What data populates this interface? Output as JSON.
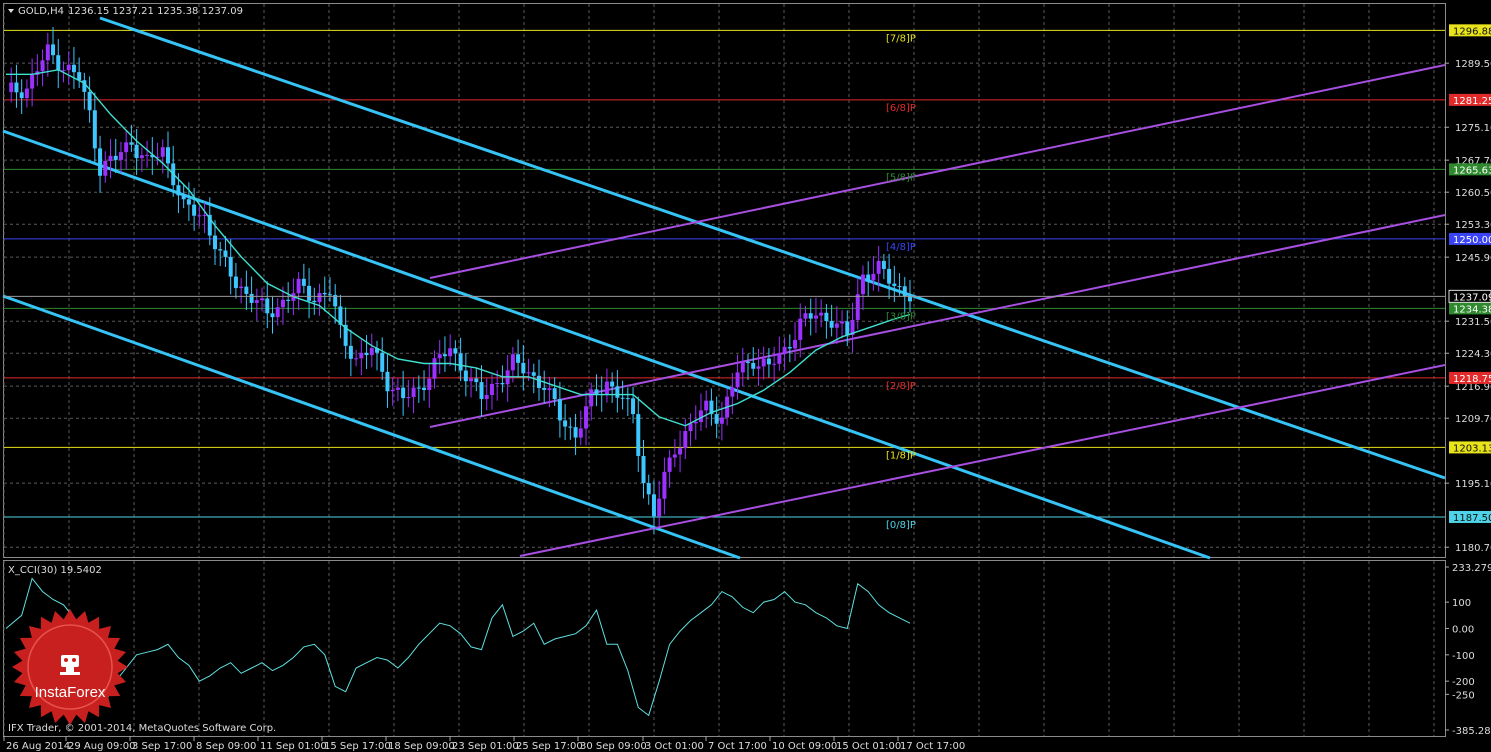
{
  "header": {
    "symbol": "GOLD,H4",
    "ohlc": "1236.15 1237.21 1235.38 1237.09"
  },
  "footer": {
    "copyright": "IFX Trader, © 2001-2014, MetaQuotes Software Corp."
  },
  "logo": {
    "text": "InstaForex",
    "color": "#c8201e"
  },
  "colors": {
    "bull": "#9b30ff",
    "bear": "#3ec6ff",
    "channel": "#36c3f5",
    "fan": "#a64fe0",
    "ma": "#3fe0d0",
    "grid": "#5a5a5a"
  },
  "chart_data": [
    {
      "type": "candlestick",
      "name": "GOLD,H4",
      "ylim": [
        1178.5,
        1302.8
      ],
      "y_ticks": [
        "1289.50",
        "1275.10",
        "1267.70",
        "1260.50",
        "1253.30",
        "1245.90",
        "1231.50",
        "1224.30",
        "1216.90",
        "1209.70",
        "1195.10",
        "1180.70"
      ],
      "x_ticks": [
        "26 Aug 2014",
        "29 Aug 09:00",
        "3 Sep 17:00",
        "8 Sep 09:00",
        "11 Sep 01:00",
        "15 Sep 17:00",
        "18 Sep 09:00",
        "23 Sep 01:00",
        "25 Sep 17:00",
        "30 Sep 09:00",
        "3 Oct 01:00",
        "7 Oct 17:00",
        "10 Oct 09:00",
        "15 Oct 01:00",
        "17 Oct 17:00"
      ],
      "close_path": [
        [
          0,
          1283
        ],
        [
          4,
          1284
        ],
        [
          8,
          1292
        ],
        [
          11,
          1289
        ],
        [
          14,
          1286
        ],
        [
          16,
          1278
        ],
        [
          18,
          1266
        ],
        [
          21,
          1268
        ],
        [
          24,
          1272
        ],
        [
          27,
          1267
        ],
        [
          30,
          1270
        ],
        [
          32,
          1264
        ],
        [
          34,
          1257
        ],
        [
          38,
          1255
        ],
        [
          41,
          1246
        ],
        [
          44,
          1240
        ],
        [
          47,
          1237
        ],
        [
          50,
          1233
        ],
        [
          53,
          1236
        ],
        [
          56,
          1239
        ],
        [
          59,
          1237
        ],
        [
          62,
          1238
        ],
        [
          64,
          1229
        ],
        [
          67,
          1223
        ],
        [
          70,
          1225
        ],
        [
          73,
          1218
        ],
        [
          76,
          1214
        ],
        [
          79,
          1216
        ],
        [
          82,
          1222
        ],
        [
          85,
          1225
        ],
        [
          88,
          1220
        ],
        [
          91,
          1214
        ],
        [
          94,
          1218
        ],
        [
          97,
          1222
        ],
        [
          100,
          1220
        ],
        [
          103,
          1217
        ],
        [
          106,
          1210
        ],
        [
          109,
          1206
        ],
        [
          112,
          1214
        ],
        [
          115,
          1218
        ],
        [
          118,
          1214
        ],
        [
          120,
          1210
        ],
        [
          122,
          1196
        ],
        [
          124,
          1188
        ],
        [
          126,
          1196
        ],
        [
          128,
          1203
        ],
        [
          131,
          1208
        ],
        [
          134,
          1212
        ],
        [
          137,
          1210
        ],
        [
          140,
          1220
        ],
        [
          143,
          1223
        ],
        [
          146,
          1221
        ],
        [
          149,
          1225
        ],
        [
          152,
          1231
        ],
        [
          155,
          1233
        ],
        [
          158,
          1232
        ],
        [
          161,
          1228
        ],
        [
          164,
          1242
        ],
        [
          167,
          1243
        ],
        [
          170,
          1240
        ],
        [
          173,
          1237
        ]
      ],
      "moving_average": [
        [
          0,
          1287
        ],
        [
          5,
          1287
        ],
        [
          10,
          1288
        ],
        [
          15,
          1285
        ],
        [
          20,
          1278
        ],
        [
          25,
          1272
        ],
        [
          30,
          1267
        ],
        [
          35,
          1261
        ],
        [
          40,
          1253
        ],
        [
          45,
          1246
        ],
        [
          50,
          1240
        ],
        [
          55,
          1237
        ],
        [
          60,
          1235
        ],
        [
          65,
          1230
        ],
        [
          70,
          1226
        ],
        [
          75,
          1223
        ],
        [
          80,
          1222
        ],
        [
          85,
          1222
        ],
        [
          90,
          1221
        ],
        [
          95,
          1219
        ],
        [
          100,
          1219
        ],
        [
          105,
          1217
        ],
        [
          110,
          1215
        ],
        [
          115,
          1215
        ],
        [
          120,
          1215
        ],
        [
          125,
          1210
        ],
        [
          130,
          1208
        ],
        [
          135,
          1211
        ],
        [
          140,
          1213
        ],
        [
          145,
          1216
        ],
        [
          150,
          1220
        ],
        [
          155,
          1225
        ],
        [
          160,
          1228
        ],
        [
          165,
          1230
        ],
        [
          170,
          1232
        ],
        [
          173,
          1233
        ]
      ],
      "murrey_levels": [
        {
          "label": "[7/8]P",
          "price": "1296.88",
          "value": 1296.88,
          "color": "#e8e31a",
          "text": "#111111"
        },
        {
          "label": "[6/8]P",
          "price": "1281.25",
          "value": 1281.25,
          "color": "#e22a2a",
          "text": "#ffffff"
        },
        {
          "label": "[5/8]P",
          "price": "1265.63",
          "value": 1265.63,
          "color": "#2f8a2f",
          "text": "#ffffff"
        },
        {
          "label": "[4/8]P",
          "price": "1250.00",
          "value": 1250.0,
          "color": "#3a44f5",
          "text": "#ffffff"
        },
        {
          "label": "[3/8]P",
          "price": "1234.38",
          "value": 1234.38,
          "color": "#2f8a2f",
          "text": "#ffffff"
        },
        {
          "label": "[2/8]P",
          "price": "1218.75",
          "value": 1218.75,
          "color": "#e22a2a",
          "text": "#ffffff"
        },
        {
          "label": "[1/8]P",
          "price": "1203.13",
          "value": 1203.13,
          "color": "#e8e31a",
          "text": "#111111"
        },
        {
          "label": "[0/8]P",
          "price": "1187.50",
          "value": 1187.5,
          "color": "#4fd3e8",
          "text": "#111111"
        }
      ],
      "current_price": {
        "price": "1237.09",
        "value": 1237.09
      }
    },
    {
      "type": "line",
      "name": "X_CCI(30) 19.5402",
      "y_ticks": [
        "233.2797",
        "100",
        "0.00",
        "-100",
        "-200",
        "-250",
        "-385.2823"
      ],
      "ylim": [
        -385.2823,
        233.2797
      ],
      "series": [
        {
          "values": [
            [
              0,
              0
            ],
            [
              3,
              50
            ],
            [
              5,
              190
            ],
            [
              7,
              140
            ],
            [
              9,
              110
            ],
            [
              11,
              90
            ],
            [
              13,
              40
            ],
            [
              15,
              -120
            ],
            [
              17,
              -200
            ],
            [
              19,
              -280
            ],
            [
              21,
              -200
            ],
            [
              23,
              -150
            ],
            [
              25,
              -100
            ],
            [
              27,
              -90
            ],
            [
              29,
              -80
            ],
            [
              31,
              -60
            ],
            [
              33,
              -110
            ],
            [
              35,
              -140
            ],
            [
              37,
              -200
            ],
            [
              39,
              -180
            ],
            [
              41,
              -150
            ],
            [
              43,
              -130
            ],
            [
              45,
              -170
            ],
            [
              47,
              -150
            ],
            [
              49,
              -130
            ],
            [
              51,
              -160
            ],
            [
              53,
              -140
            ],
            [
              55,
              -110
            ],
            [
              57,
              -70
            ],
            [
              59,
              -60
            ],
            [
              61,
              -100
            ],
            [
              63,
              -220
            ],
            [
              65,
              -240
            ],
            [
              67,
              -150
            ],
            [
              69,
              -130
            ],
            [
              71,
              -110
            ],
            [
              73,
              -120
            ],
            [
              75,
              -150
            ],
            [
              77,
              -110
            ],
            [
              79,
              -60
            ],
            [
              81,
              -20
            ],
            [
              83,
              20
            ],
            [
              85,
              10
            ],
            [
              87,
              -20
            ],
            [
              89,
              -70
            ],
            [
              91,
              -80
            ],
            [
              93,
              40
            ],
            [
              95,
              90
            ],
            [
              97,
              -30
            ],
            [
              99,
              -10
            ],
            [
              101,
              20
            ],
            [
              103,
              -60
            ],
            [
              105,
              -40
            ],
            [
              107,
              -30
            ],
            [
              109,
              -20
            ],
            [
              111,
              10
            ],
            [
              113,
              70
            ],
            [
              115,
              -60
            ],
            [
              117,
              -60
            ],
            [
              119,
              -160
            ],
            [
              121,
              -300
            ],
            [
              123,
              -330
            ],
            [
              125,
              -200
            ],
            [
              127,
              -60
            ],
            [
              129,
              -10
            ],
            [
              131,
              30
            ],
            [
              133,
              60
            ],
            [
              135,
              90
            ],
            [
              137,
              140
            ],
            [
              139,
              120
            ],
            [
              141,
              80
            ],
            [
              143,
              60
            ],
            [
              145,
              100
            ],
            [
              147,
              110
            ],
            [
              149,
              140
            ],
            [
              151,
              100
            ],
            [
              153,
              90
            ],
            [
              155,
              60
            ],
            [
              157,
              40
            ],
            [
              159,
              10
            ],
            [
              161,
              0
            ],
            [
              163,
              170
            ],
            [
              165,
              140
            ],
            [
              167,
              90
            ],
            [
              169,
              60
            ],
            [
              171,
              40
            ],
            [
              173,
              20
            ]
          ]
        }
      ]
    }
  ]
}
